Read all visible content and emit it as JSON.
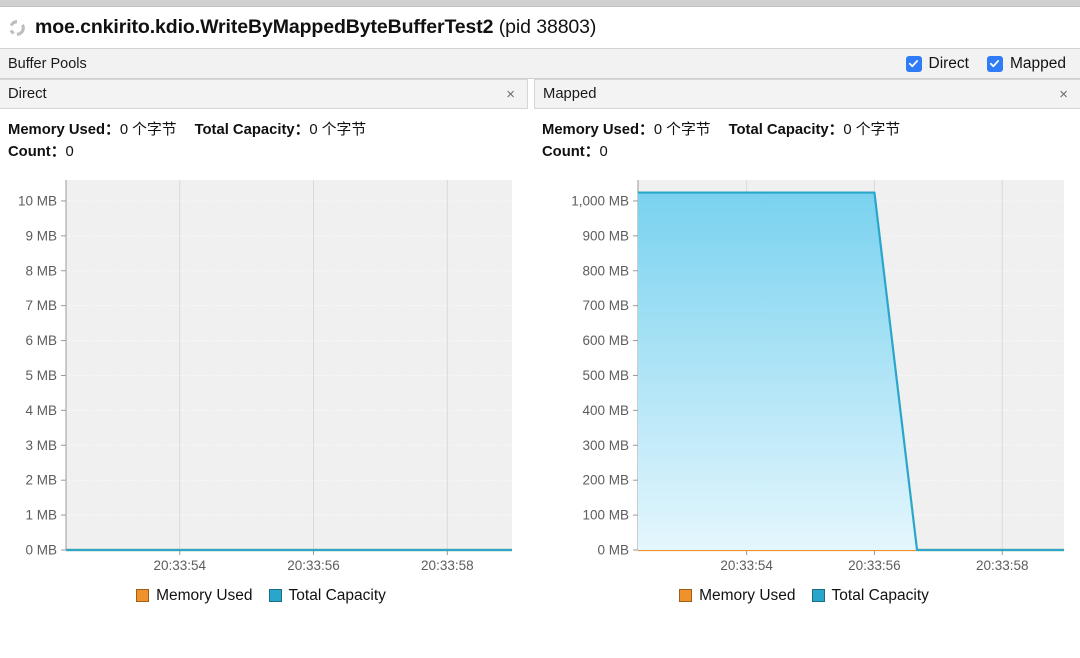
{
  "window": {
    "spinner_icon": "loading-spinner-icon",
    "title_class": "moe.cnkirito.kdio.WriteByMappedByteBufferTest2",
    "title_pid": "(pid 38803)"
  },
  "toolbar": {
    "title": "Buffer Pools",
    "checkboxes": [
      {
        "label": "Direct",
        "checked": true,
        "icon": "check-icon"
      },
      {
        "label": "Mapped",
        "checked": true,
        "icon": "check-icon"
      }
    ],
    "accent_color": "#2f7cf6"
  },
  "panels": [
    {
      "title": "Direct",
      "close_icon": "close-icon",
      "close_label": "×",
      "stats": {
        "memory_used_label": "Memory Used：",
        "memory_used_value": "0 个字节",
        "total_capacity_label": "Total Capacity：",
        "total_capacity_value": "0 个字节",
        "count_label": "Count：",
        "count_value": "0"
      },
      "legend": [
        {
          "label": "Memory Used",
          "color": "#f0922b"
        },
        {
          "label": "Total Capacity",
          "color": "#2ba6cb"
        }
      ]
    },
    {
      "title": "Mapped",
      "close_icon": "close-icon",
      "close_label": "×",
      "stats": {
        "memory_used_label": "Memory Used：",
        "memory_used_value": "0 个字节",
        "total_capacity_label": "Total Capacity：",
        "total_capacity_value": "0 个字节",
        "count_label": "Count：",
        "count_value": "0"
      },
      "legend": [
        {
          "label": "Memory Used",
          "color": "#f0922b"
        },
        {
          "label": "Total Capacity",
          "color": "#2ba6cb"
        }
      ]
    }
  ],
  "chart_data": [
    {
      "type": "area",
      "title": "Direct",
      "xlabel": "",
      "ylabel": "",
      "grid": true,
      "legend_position": "bottom",
      "plot_bg": "#f0f0f0",
      "yticks": [
        "0 MB",
        "1 MB",
        "2 MB",
        "3 MB",
        "4 MB",
        "5 MB",
        "6 MB",
        "7 MB",
        "8 MB",
        "9 MB",
        "10 MB"
      ],
      "ytick_values": [
        0,
        1,
        2,
        3,
        4,
        5,
        6,
        7,
        8,
        9,
        10
      ],
      "ylim": [
        0,
        10.6
      ],
      "yunit": "MB",
      "xticks": [
        "20:33:54",
        "20:33:56",
        "20:33:58"
      ],
      "xtick_positions": [
        0.255,
        0.555,
        0.855
      ],
      "series": [
        {
          "name": "Memory Used",
          "color": "#f0922b",
          "x": [
            0,
            1
          ],
          "values": [
            0,
            0
          ]
        },
        {
          "name": "Total Capacity",
          "color": "#2ba6cb",
          "x": [
            0,
            1
          ],
          "values": [
            0,
            0
          ]
        }
      ]
    },
    {
      "type": "area",
      "title": "Mapped",
      "xlabel": "",
      "ylabel": "",
      "grid": true,
      "legend_position": "bottom",
      "plot_bg": "#f0f0f0",
      "yticks": [
        "0 MB",
        "100 MB",
        "200 MB",
        "300 MB",
        "400 MB",
        "500 MB",
        "600 MB",
        "700 MB",
        "800 MB",
        "900 MB",
        "1,000 MB"
      ],
      "ytick_values": [
        0,
        100,
        200,
        300,
        400,
        500,
        600,
        700,
        800,
        900,
        1000
      ],
      "ylim": [
        0,
        1060
      ],
      "yunit": "MB",
      "xticks": [
        "20:33:54",
        "20:33:56",
        "20:33:58"
      ],
      "xtick_positions": [
        0.255,
        0.555,
        0.855
      ],
      "series": [
        {
          "name": "Memory Used",
          "color": "#f0922b",
          "x": [
            0,
            1
          ],
          "values": [
            0,
            0
          ]
        },
        {
          "name": "Total Capacity",
          "color": "#2ba6cb",
          "fill_top": "#79d2ef",
          "fill_bottom": "#e4f6fd",
          "x": [
            0.0,
            0.555,
            0.655,
            1.0
          ],
          "values": [
            1024,
            1024,
            0,
            0
          ]
        }
      ]
    }
  ]
}
